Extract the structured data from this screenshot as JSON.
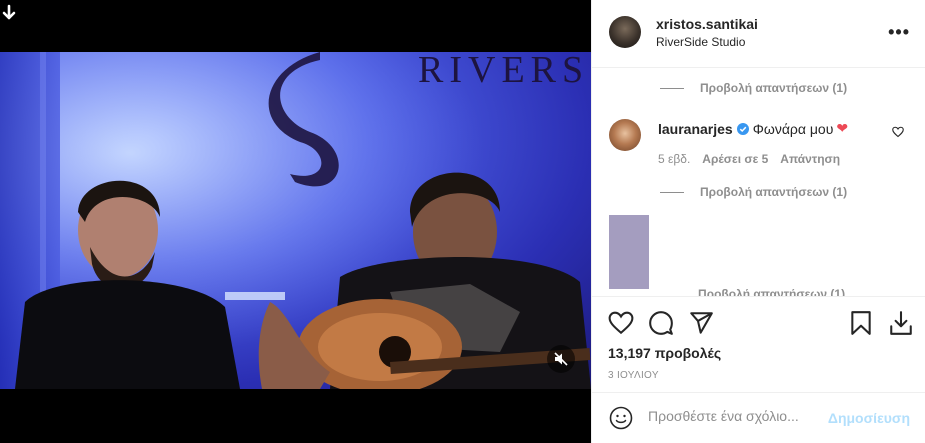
{
  "post": {
    "username": "xristos.santikai",
    "location": "RiverSide Studio",
    "more_icon": "more-horizontal-icon",
    "video": {
      "signage_text": "RIVERS",
      "muted": true,
      "mute_icon": "speaker-muted-icon"
    }
  },
  "comments": {
    "view_replies_label": "Προβολή απαντήσεων (1)",
    "items": [
      {
        "username": "lauranarjes",
        "verified": true,
        "text": "Φωνάρα μου",
        "emoji": "❤",
        "time": "5 εβδ.",
        "likes": "Αρέσει σε 5",
        "reply": "Απάντηση"
      }
    ],
    "second_view_replies_label": "Προβολή απαντήσεων (1)",
    "cut_off_text": "Προβολή απαντήσεων (1)"
  },
  "actions": {
    "like_icon": "heart-icon",
    "comment_icon": "comment-icon",
    "share_icon": "send-icon",
    "save_icon": "bookmark-icon",
    "download_icon": "download-icon",
    "views": "13,197 προβολές",
    "date": "3 ΙΟΥΛΙΟΥ"
  },
  "add_comment": {
    "placeholder": "Προσθέστε ένα σχόλιο...",
    "post_label": "Δημοσίευση"
  },
  "colors": {
    "accent_blue": "#0095f6",
    "post_disabled": "#b2dffc",
    "verified_blue": "#3897f0",
    "heart_red": "#ed4956",
    "muted_text": "#8e8e8e",
    "stage_blue": "#4f62e8"
  }
}
